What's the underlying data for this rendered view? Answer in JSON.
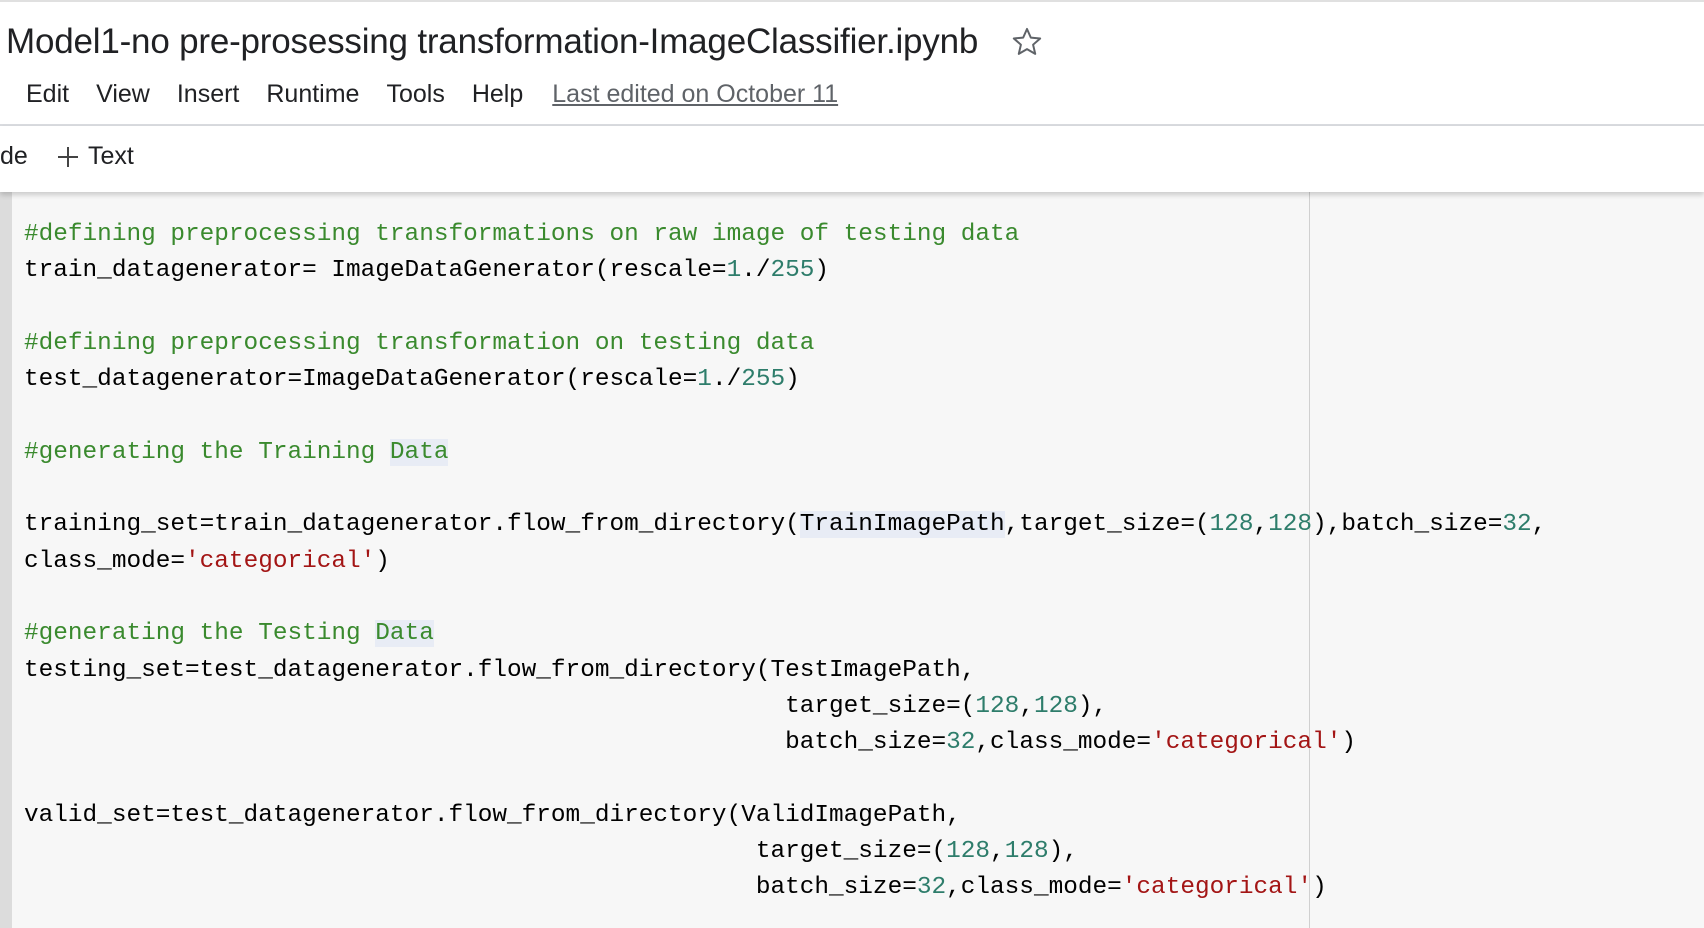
{
  "header": {
    "title": "Model1-no pre-prosessing transformation-ImageClassifier.ipynb",
    "star_icon": "star-outline-icon"
  },
  "menu": {
    "items": [
      "Edit",
      "View",
      "Insert",
      "Runtime",
      "Tools",
      "Help"
    ],
    "last_edited": "Last edited on October 11"
  },
  "toolbar": {
    "code_label": "de",
    "text_label": "Text",
    "plus_icon": "plus-icon"
  },
  "code": {
    "lines": [
      [
        {
          "t": "comment",
          "v": "#defining preprocessing transformations on raw image of testing data"
        }
      ],
      [
        {
          "t": "plain",
          "v": "train_datagenerator= ImageDataGenerator(rescale="
        },
        {
          "t": "number",
          "v": "1"
        },
        {
          "t": "plain",
          "v": "./"
        },
        {
          "t": "number",
          "v": "255"
        },
        {
          "t": "plain",
          "v": ")"
        }
      ],
      [],
      [
        {
          "t": "comment",
          "v": "#defining preprocessing transformation on testing data"
        }
      ],
      [
        {
          "t": "plain",
          "v": "test_datagenerator=ImageDataGenerator(rescale="
        },
        {
          "t": "number",
          "v": "1"
        },
        {
          "t": "plain",
          "v": "./"
        },
        {
          "t": "number",
          "v": "255"
        },
        {
          "t": "plain",
          "v": ")"
        }
      ],
      [],
      [
        {
          "t": "comment",
          "v": "#generating the Training "
        },
        {
          "t": "comment-hl",
          "v": "Data"
        }
      ],
      [],
      [
        {
          "t": "plain",
          "v": "training_set=train_datagenerator.flow_from_directory("
        },
        {
          "t": "plain-hl",
          "v": "TrainImagePath"
        },
        {
          "t": "plain",
          "v": ",target_size=("
        },
        {
          "t": "number",
          "v": "128"
        },
        {
          "t": "plain",
          "v": ","
        },
        {
          "t": "number",
          "v": "128"
        },
        {
          "t": "plain",
          "v": "),batch_size="
        },
        {
          "t": "number",
          "v": "32"
        },
        {
          "t": "plain",
          "v": ","
        }
      ],
      [
        {
          "t": "plain",
          "v": "class_mode="
        },
        {
          "t": "string",
          "v": "'categorical'"
        },
        {
          "t": "plain",
          "v": ")"
        }
      ],
      [],
      [
        {
          "t": "comment",
          "v": "#generating the Testing "
        },
        {
          "t": "comment-hl",
          "v": "Data"
        }
      ],
      [
        {
          "t": "plain",
          "v": "testing_set=test_datagenerator.flow_from_directory(TestImagePath,"
        }
      ],
      [
        {
          "t": "plain",
          "v": "                                                    target_size=("
        },
        {
          "t": "number",
          "v": "128"
        },
        {
          "t": "plain",
          "v": ","
        },
        {
          "t": "number",
          "v": "128"
        },
        {
          "t": "plain",
          "v": "),"
        }
      ],
      [
        {
          "t": "plain",
          "v": "                                                    batch_size="
        },
        {
          "t": "number",
          "v": "32"
        },
        {
          "t": "plain",
          "v": ",class_mode="
        },
        {
          "t": "string",
          "v": "'categorical'"
        },
        {
          "t": "plain",
          "v": ")"
        }
      ],
      [],
      [
        {
          "t": "plain",
          "v": "valid_set=test_datagenerator.flow_from_directory(ValidImagePath,"
        }
      ],
      [
        {
          "t": "plain",
          "v": "                                                  target_size=("
        },
        {
          "t": "number",
          "v": "128"
        },
        {
          "t": "plain",
          "v": ","
        },
        {
          "t": "number",
          "v": "128"
        },
        {
          "t": "plain",
          "v": "),"
        }
      ],
      [
        {
          "t": "plain",
          "v": "                                                  batch_size="
        },
        {
          "t": "number",
          "v": "32"
        },
        {
          "t": "plain",
          "v": ",class_mode="
        },
        {
          "t": "string",
          "v": "'categorical'"
        },
        {
          "t": "plain",
          "v": ")"
        }
      ]
    ]
  },
  "colors": {
    "comment": "#3a8a2e",
    "number": "#2e7d6b",
    "string": "#a31515",
    "cell_background": "#f7f7f7"
  }
}
